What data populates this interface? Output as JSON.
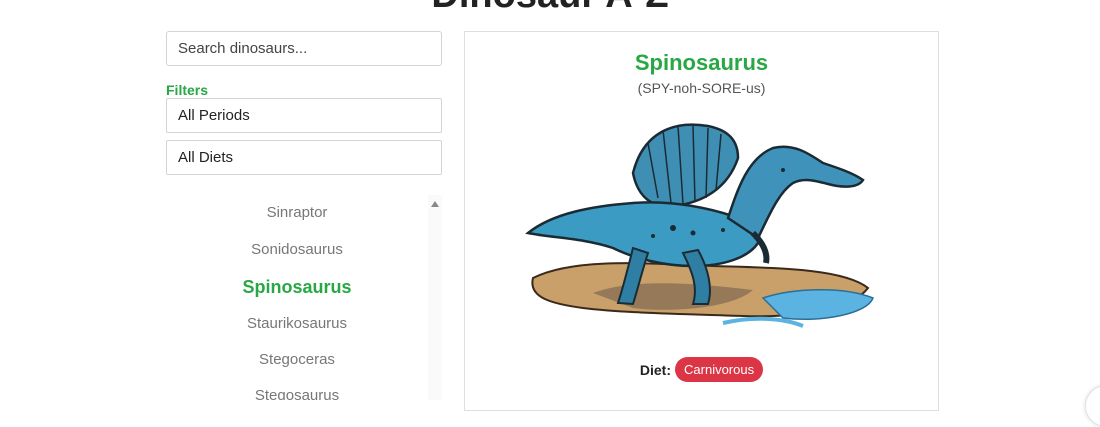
{
  "header": {
    "title": "Dinosaur A-Z"
  },
  "sidebar": {
    "search_placeholder": "Search dinosaurs...",
    "filters_label": "Filters",
    "period_filter": "All Periods",
    "diet_filter": "All Diets",
    "list": [
      {
        "name": "Sinraptor",
        "selected": false
      },
      {
        "name": "Sonidosaurus",
        "selected": false
      },
      {
        "name": "Spinosaurus",
        "selected": true
      },
      {
        "name": "Staurikosaurus",
        "selected": false
      },
      {
        "name": "Stegoceras",
        "selected": false
      },
      {
        "name": "Stegosaurus",
        "selected": false
      }
    ]
  },
  "detail": {
    "name": "Spinosaurus",
    "pronunciation": "(SPY-noh-SORE-us)",
    "diet_label": "Diet:",
    "diet_value": "Carnivorous",
    "illustration": "spinosaurus-illustration"
  },
  "colors": {
    "accent": "#28a745",
    "diet_badge": "#dc3545"
  }
}
